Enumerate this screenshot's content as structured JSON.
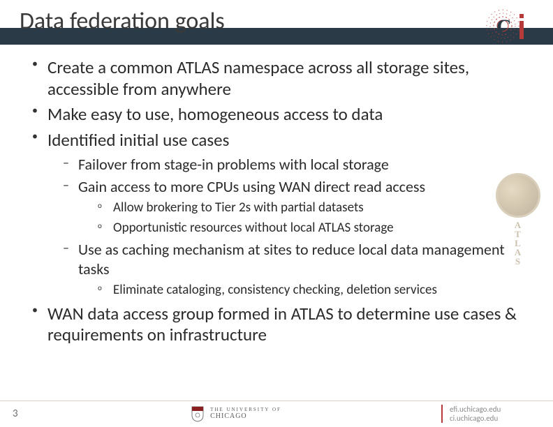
{
  "slide": {
    "title": "Data federation goals",
    "number": "3"
  },
  "bullets": {
    "b1": "Create a common ATLAS namespace across all storage sites, accessible from anywhere",
    "b2": "Make easy to use, homogeneous access to data",
    "b3": "Identified initial use cases",
    "b3_1": "Failover from stage-in problems with local storage",
    "b3_2": "Gain access to more CPUs using WAN direct read access",
    "b3_2_1": "Allow brokering to Tier 2s with partial datasets",
    "b3_2_2": "Opportunistic resources without local ATLAS storage",
    "b3_3": "Use as caching mechanism at sites to reduce local data management tasks",
    "b3_3_1": "Eliminate cataloging, consistency checking, deletion services",
    "b4": "WAN data access group formed in ATLAS to determine use cases & requirements on infrastructure"
  },
  "footer": {
    "university_line1": "THE UNIVERSITY OF",
    "university_line2": "CHICAGO",
    "url1": "efi.uchicago.edu",
    "url2": "ci.uchicago.edu"
  },
  "atlas_letters": [
    "A",
    "T",
    "L",
    "A",
    "S"
  ]
}
